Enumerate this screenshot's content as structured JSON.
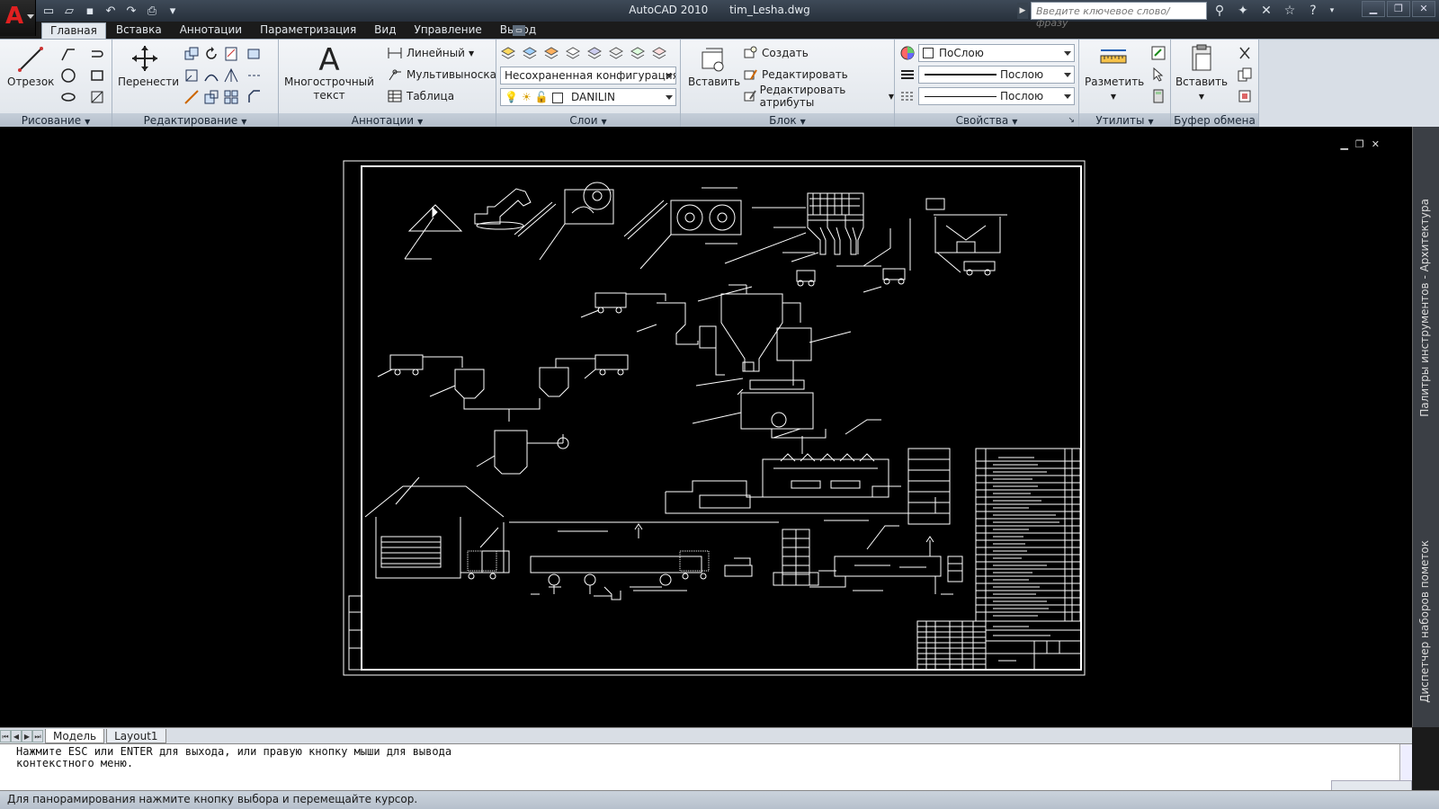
{
  "app": {
    "title": "AutoCAD 2010",
    "file": "tim_Lesha.dwg",
    "logo": "A",
    "search_placeholder": "Введите ключевое слово/фразу"
  },
  "tabs": [
    "Главная",
    "Вставка",
    "Аннотации",
    "Параметризация",
    "Вид",
    "Управление",
    "Вывод"
  ],
  "ribbon": {
    "draw": {
      "label": "Рисование",
      "line": "Отрезок"
    },
    "modify": {
      "label": "Редактирование",
      "move": "Перенести"
    },
    "annot": {
      "label": "Аннотации",
      "mtext_1": "Многострочный",
      "mtext_2": "текст",
      "linear": "Линейный",
      "mleader": "Мультивыноска",
      "table": "Таблица"
    },
    "layers": {
      "label": "Слои",
      "config": "Несохраненная конфигурация сл",
      "current": "DANILIN"
    },
    "block": {
      "label": "Блок",
      "insert": "Вставить",
      "create": "Создать",
      "edit": "Редактировать",
      "edit_attr": "Редактировать атрибуты"
    },
    "props": {
      "label": "Свойства",
      "color": "ПоСлою",
      "linetype": "Послою",
      "lineweight": "Послою"
    },
    "utils": {
      "label": "Утилиты",
      "measure": "Разметить"
    },
    "clipboard": {
      "label": "Буфер обмена",
      "paste": "Вставить"
    }
  },
  "palettes": {
    "tool": "Палитры инструментов - Архитектура",
    "markup": "Диспетчер наборов пометок"
  },
  "layout_tabs": [
    "Модель",
    "Layout1"
  ],
  "command": {
    "line1": "Нажмите ESC или ENTER для выхода, или правую кнопку мыши для вывода",
    "line2": "контекстного меню."
  },
  "status": "Для панорамирования нажмите кнопку выбора и перемещайте курсор.",
  "colors": {
    "cad_bg": "#000000",
    "cad_line": "#ffffff",
    "ribbon": "#e6eaef",
    "title_bar": "#2f3945",
    "logo": "#e02020"
  }
}
